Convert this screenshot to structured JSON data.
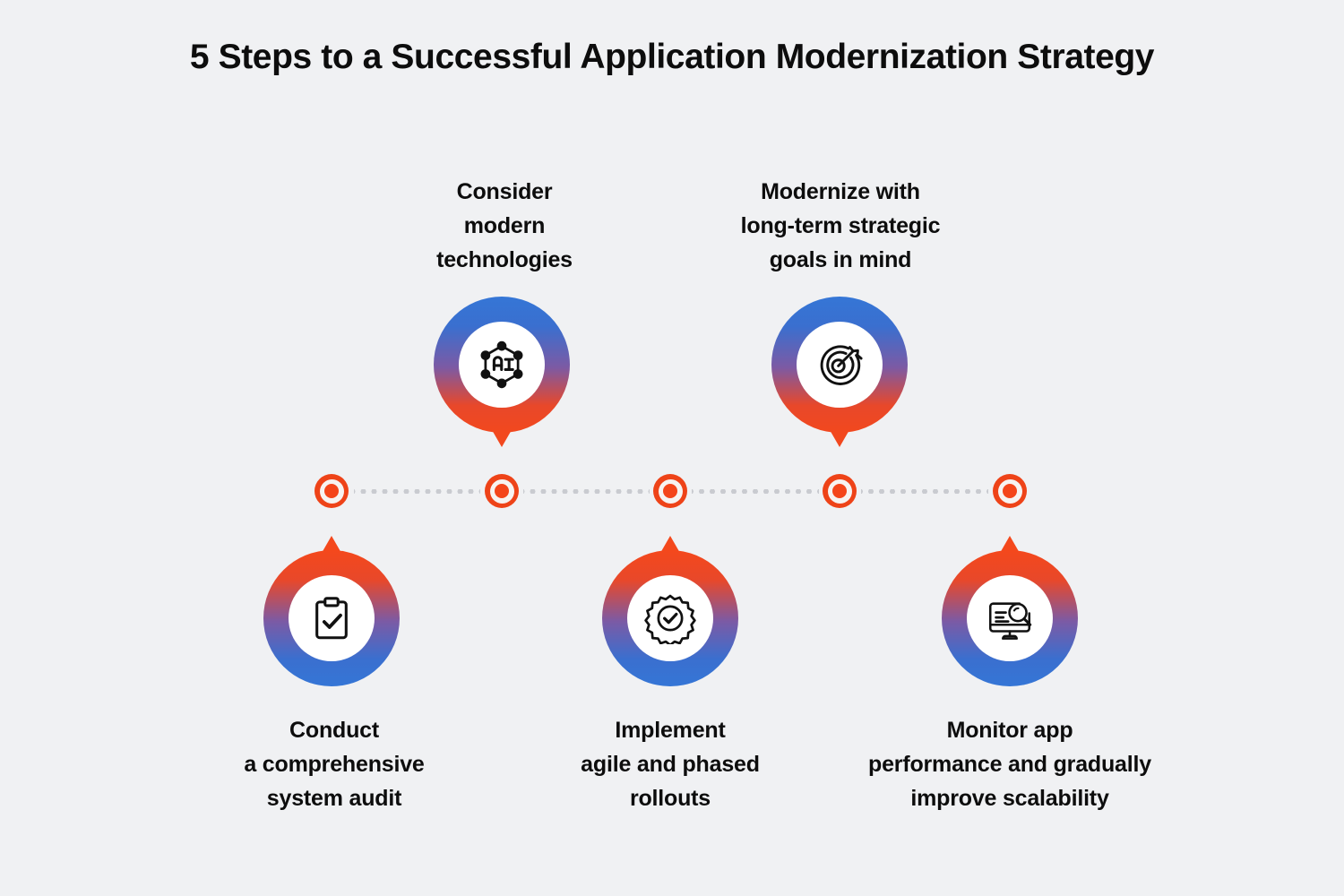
{
  "title": "5 Steps to a Successful Application Modernization Strategy",
  "colors": {
    "background": "#F0F1F3",
    "text": "#0D0D0D",
    "accent_blue": "#3576D6",
    "accent_red": "#F2481E",
    "dot_red": "#EE4318",
    "line_gray": "#C9CBD0"
  },
  "timeline": {
    "dots": [
      {
        "id": "dot-1",
        "step": 1
      },
      {
        "id": "dot-2",
        "step": 2
      },
      {
        "id": "dot-3",
        "step": 3
      },
      {
        "id": "dot-4",
        "step": 4
      },
      {
        "id": "dot-5",
        "step": 5
      }
    ],
    "connector_style": "dotted"
  },
  "steps": [
    {
      "step": 1,
      "position": "below",
      "icon": "clipboard-check-icon",
      "lines": [
        "Conduct",
        "a comprehensive",
        "system audit"
      ],
      "text": "Conduct a comprehensive system audit"
    },
    {
      "step": 2,
      "position": "above",
      "icon": "ai-network-icon",
      "lines": [
        "Consider",
        "modern",
        "technologies"
      ],
      "text": "Consider modern technologies"
    },
    {
      "step": 3,
      "position": "below",
      "icon": "gear-check-icon",
      "lines": [
        "Implement",
        "agile and phased",
        "rollouts"
      ],
      "text": "Implement agile and phased rollouts"
    },
    {
      "step": 4,
      "position": "above",
      "icon": "target-arrow-icon",
      "lines": [
        "Modernize with",
        "long-term strategic",
        "goals in mind"
      ],
      "text": "Modernize with long-term strategic goals in mind"
    },
    {
      "step": 5,
      "position": "below",
      "icon": "monitor-search-icon",
      "lines": [
        "Monitor app",
        "performance and gradually",
        "improve scalability"
      ],
      "text": "Monitor app performance and gradually improve scalability"
    }
  ]
}
